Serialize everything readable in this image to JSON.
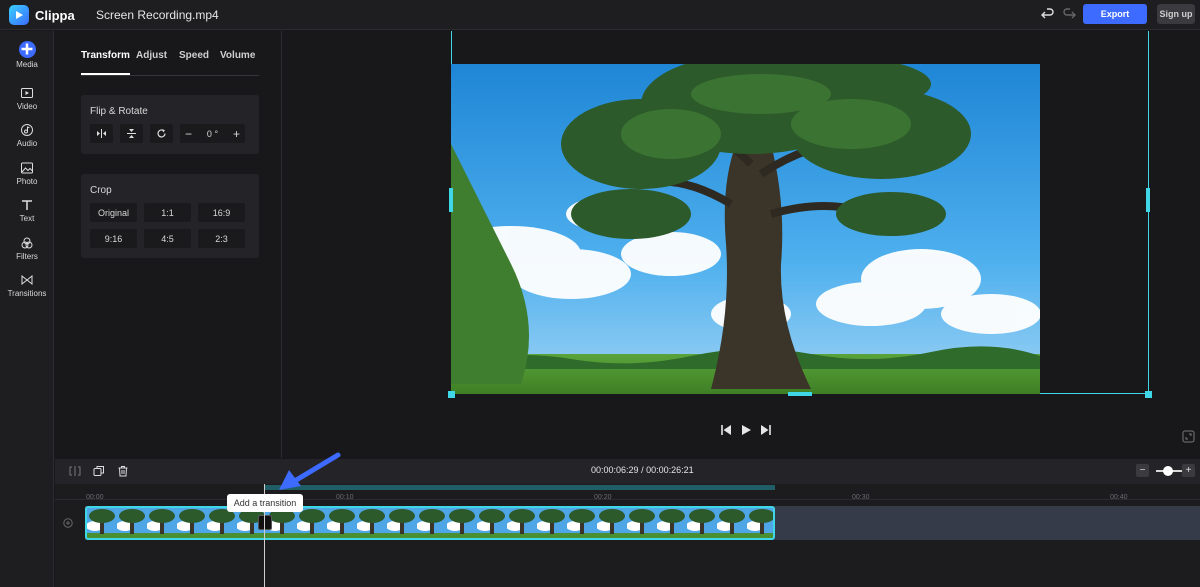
{
  "app": {
    "name": "Clippa",
    "file_name": "Screen Recording.mp4"
  },
  "header": {
    "export_label": "Export",
    "signup_label": "Sign up"
  },
  "rail": {
    "items": [
      {
        "label": "Media",
        "icon": "plus-icon"
      },
      {
        "label": "Video",
        "icon": "video-icon"
      },
      {
        "label": "Audio",
        "icon": "audio-icon"
      },
      {
        "label": "Photo",
        "icon": "photo-icon"
      },
      {
        "label": "Text",
        "icon": "text-icon"
      },
      {
        "label": "Filters",
        "icon": "filters-icon"
      },
      {
        "label": "Transitions",
        "icon": "transitions-icon"
      }
    ]
  },
  "panel": {
    "tabs": [
      "Transform",
      "Adjust",
      "Speed",
      "Volume"
    ],
    "active_tab": "Transform",
    "flip_rotate": {
      "title": "Flip & Rotate",
      "angle_value": "0",
      "angle_unit": "°",
      "minus": "−",
      "plus": "+"
    },
    "crop": {
      "title": "Crop",
      "options": [
        "Original",
        "1:1",
        "16:9",
        "9:16",
        "4:5",
        "2:3"
      ]
    }
  },
  "timeline": {
    "current_time": "00:00:06:29",
    "total_time": "00:00:26:21",
    "separator": "/",
    "ruler_ticks": [
      "00:00",
      "00:10",
      "00:20",
      "00:30",
      "00:40"
    ],
    "tooltip": "Add a transition",
    "zoom_minus": "−",
    "zoom_plus": "+"
  },
  "colors": {
    "accent": "#3d6bff",
    "selection": "#3fd6e8"
  }
}
